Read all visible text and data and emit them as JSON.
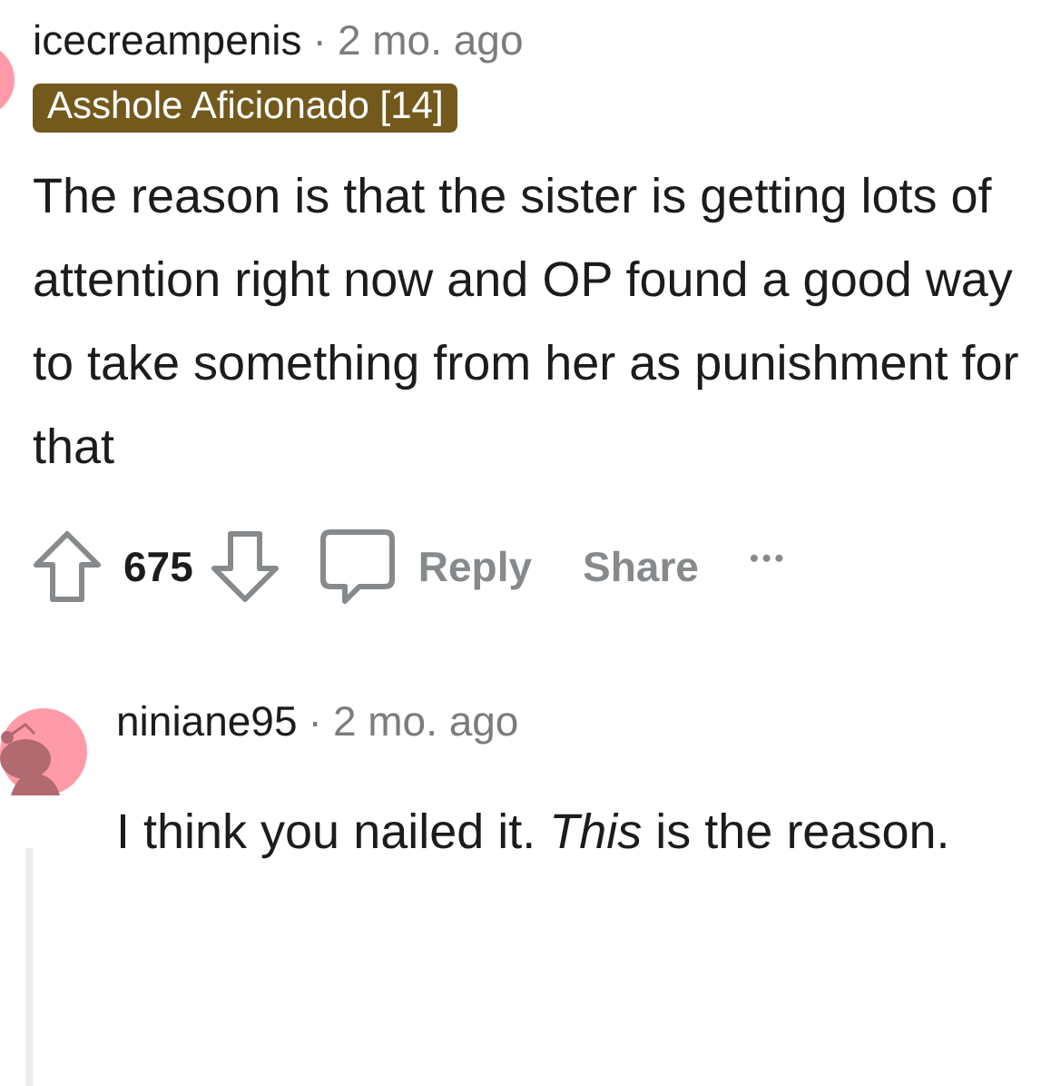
{
  "comments": [
    {
      "author": "icecreampenis",
      "separator": "·",
      "time": "2 mo. ago",
      "flair": "Asshole Aficionado [14]",
      "body": "The reason is that the sister is getting lots of attention right now and OP found a good way to take something from her as punishment for that",
      "score": "675",
      "actions": [
        "Reply",
        "Share"
      ],
      "more": "•••"
    },
    {
      "author": "niniane95",
      "separator": "·",
      "time": "2 mo. ago",
      "body": "I think you nailed it. *This* is the reason."
    }
  ]
}
